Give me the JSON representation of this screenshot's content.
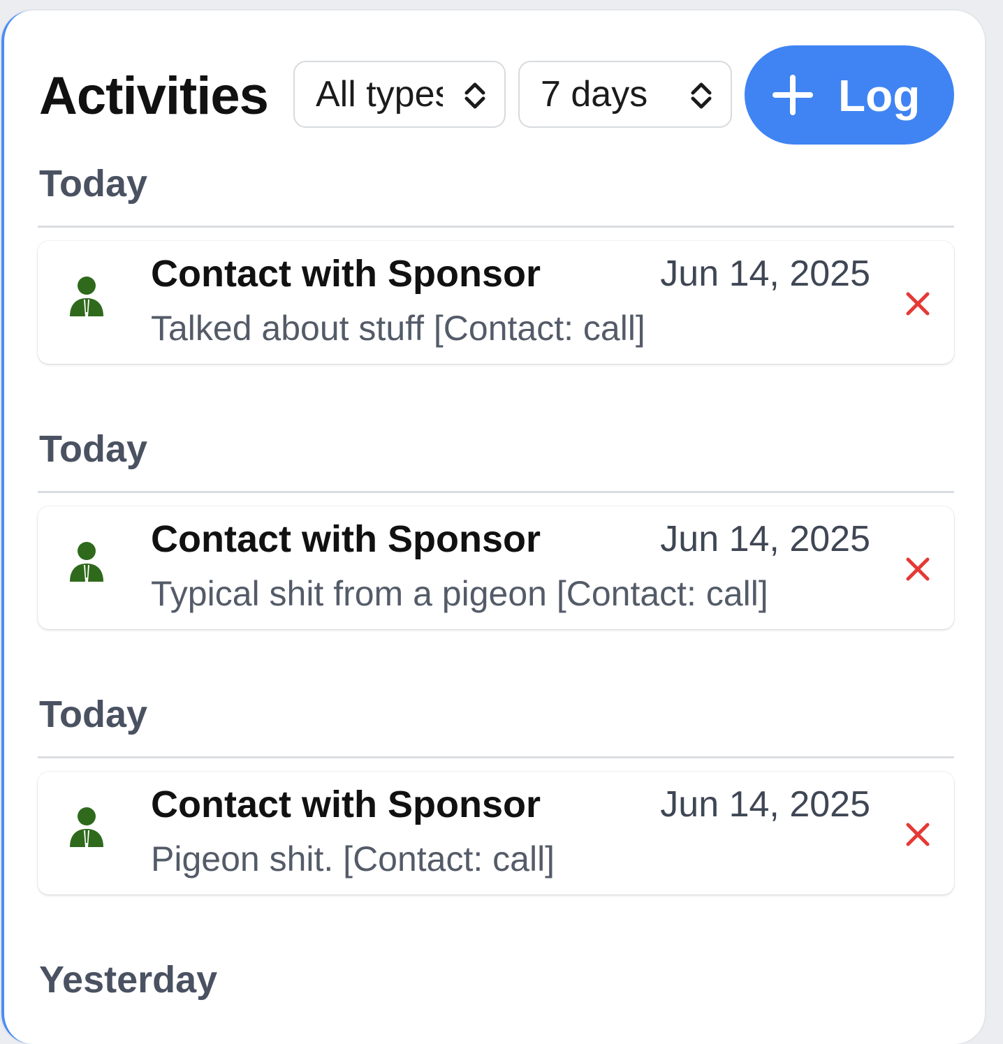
{
  "header": {
    "title": "Activities",
    "type_filter": {
      "selected": "All types"
    },
    "range_filter": {
      "selected": "7 days"
    },
    "log_button_label": "Log"
  },
  "colors": {
    "accent": "#3f84f2",
    "contact_icon": "#2f6a1c",
    "delete_icon": "#e53935"
  },
  "groups": [
    {
      "label": "Today",
      "activities": [
        {
          "icon": "person-icon",
          "title": "Contact with Sponsor",
          "date": "Jun 14, 2025",
          "description": "Talked about stuff [Contact: call]"
        }
      ]
    },
    {
      "label": "Today",
      "activities": [
        {
          "icon": "person-icon",
          "title": "Contact with Sponsor",
          "date": "Jun 14, 2025",
          "description": "Typical shit from a pigeon [Contact: call]"
        }
      ]
    },
    {
      "label": "Today",
      "activities": [
        {
          "icon": "person-icon",
          "title": "Contact with Sponsor",
          "date": "Jun 14, 2025",
          "description": "Pigeon shit. [Contact: call]"
        }
      ]
    },
    {
      "label": "Yesterday",
      "activities": []
    }
  ]
}
